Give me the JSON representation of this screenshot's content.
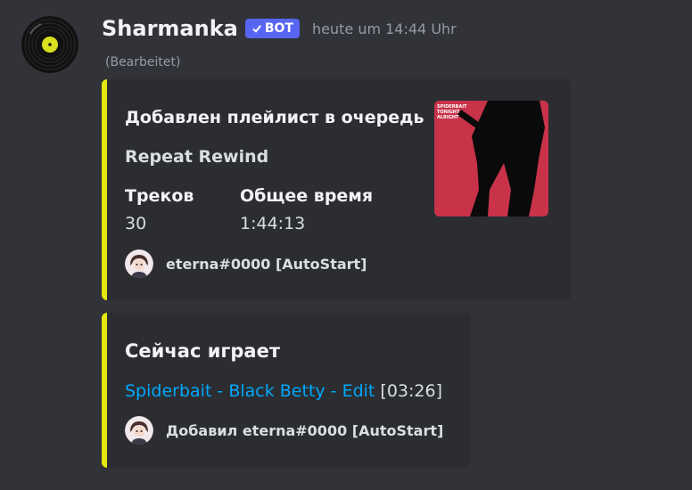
{
  "message": {
    "author": "Sharmanka",
    "bot_label": "BOT",
    "timestamp": "heute um 14:44 Uhr",
    "edited": "(Bearbeitet)"
  },
  "embed_playlist": {
    "title": "Добавлен плейлист в очередь",
    "playlist_name": "Repeat Rewind",
    "fields": [
      {
        "name": "Треков",
        "value": "30"
      },
      {
        "name": "Общее время",
        "value": "1:44:13"
      }
    ],
    "thumbnail_text": "SPIDERBAIT TONIGHT ALRIGHT",
    "footer": "eterna#0000 [AutoStart]"
  },
  "embed_now_playing": {
    "title": "Сейчас играет",
    "track_link": "Spiderbait - Black Betty - Edit",
    "duration": "[03:26]",
    "footer": "Добавил eterna#0000 [AutoStart]"
  },
  "colors": {
    "background": "#313338",
    "embed_bg": "#2b2d31",
    "embed_accent": "#e5e70f",
    "link": "#00a8fc",
    "bot_tag": "#5865f2"
  }
}
